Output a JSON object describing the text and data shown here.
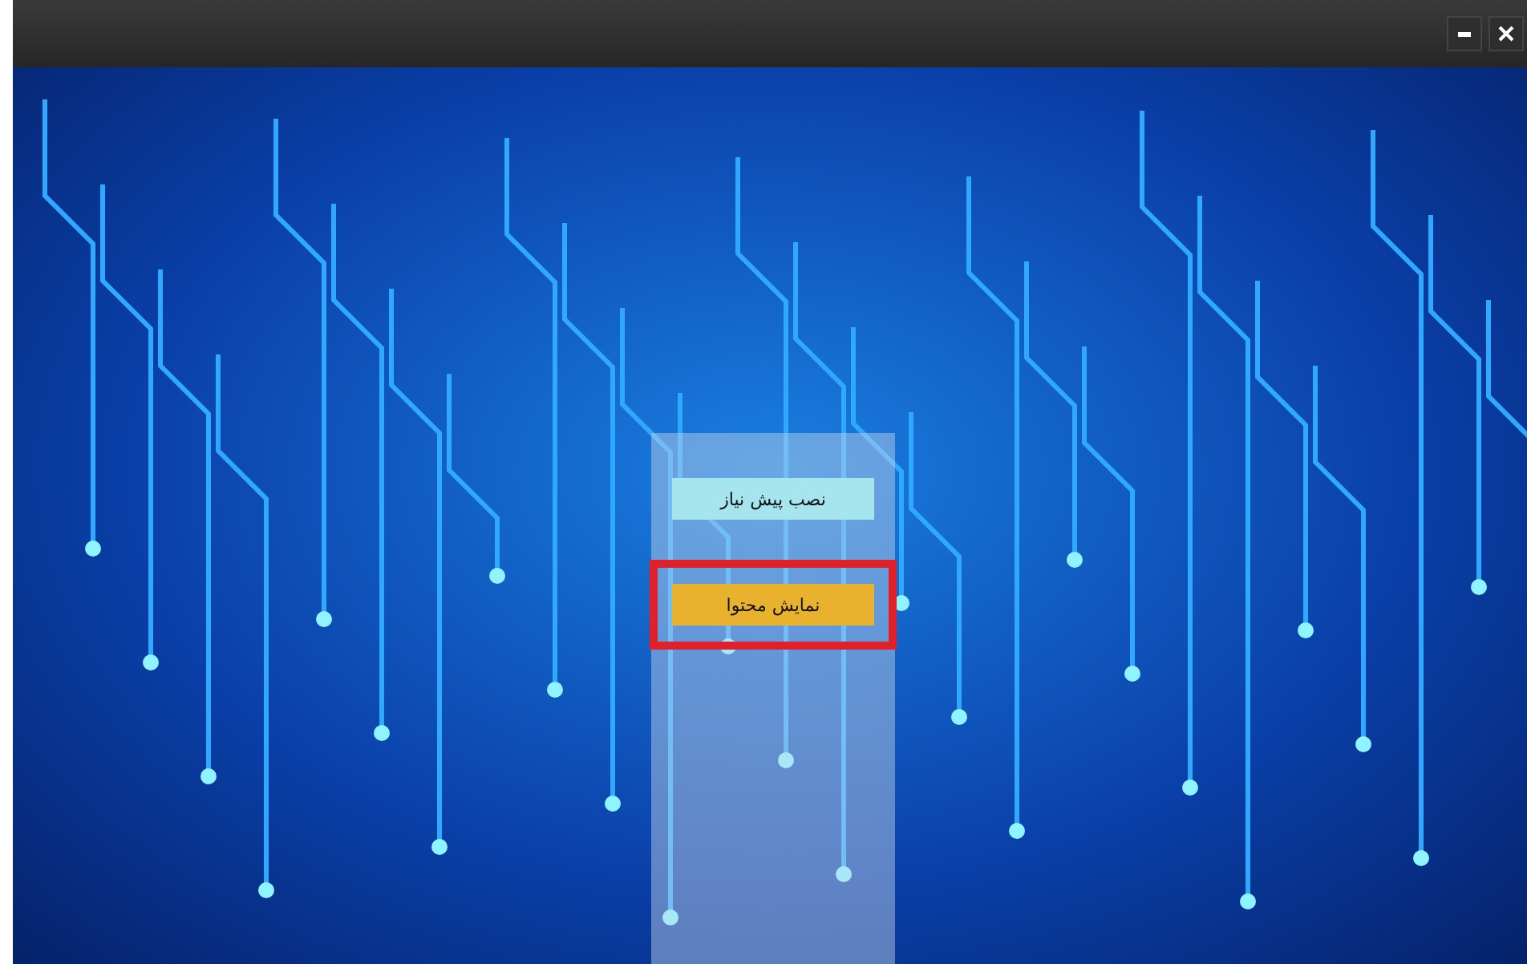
{
  "window": {
    "controls": [
      {
        "kind": "minimize"
      },
      {
        "kind": "close"
      }
    ]
  },
  "menu": {
    "buttons": [
      {
        "label": "نصب  پیش نیاز",
        "kind": "secondary",
        "highlighted": false
      },
      {
        "label": "نمایش محتوا",
        "kind": "primary",
        "highlighted": true
      }
    ]
  }
}
